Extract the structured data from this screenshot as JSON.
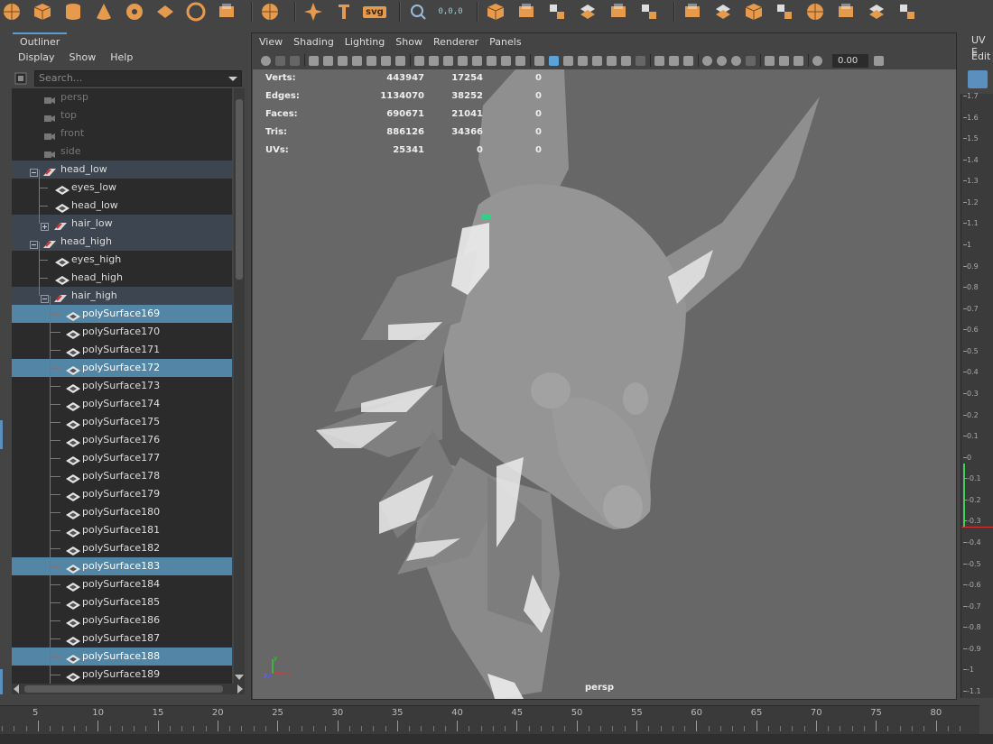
{
  "shelf": {
    "icons": [
      "sphere-icon",
      "cube-icon",
      "cylinder-icon",
      "cone-icon",
      "torus-icon",
      "plane-icon",
      "disc-icon",
      "soccerball-icon",
      "star-icon",
      "text-icon",
      "svg-icon",
      "sculpt-icon",
      "snap-icon",
      "polygon-tools-icon",
      "combine-icon",
      "separate-icon",
      "extract-icon",
      "bridge-icon",
      "extrude-icon",
      "bevel-icon",
      "append-icon",
      "insert-loop-icon",
      "multi-cut-icon",
      "target-weld-icon",
      "connect-icon",
      "collapse-icon",
      "smooth-icon",
      "mirror-icon",
      "reduce-icon"
    ],
    "svg_label": "svg",
    "coord_label": "0,0,0"
  },
  "outliner": {
    "tab": "Outliner",
    "menu": [
      "Display",
      "Show",
      "Help"
    ],
    "search_placeholder": "Search...",
    "cameras": [
      "persp",
      "top",
      "front",
      "side"
    ],
    "groups": {
      "head_low": "head_low",
      "eyes_low": "eyes_low",
      "head_low_mesh": "head_low",
      "hair_low": "hair_low",
      "head_high": "head_high",
      "eyes_high": "eyes_high",
      "head_high_mesh": "head_high",
      "hair_high": "hair_high"
    },
    "surfaces": [
      {
        "name": "polySurface169",
        "selected": true
      },
      {
        "name": "polySurface170",
        "selected": false
      },
      {
        "name": "polySurface171",
        "selected": false
      },
      {
        "name": "polySurface172",
        "selected": true
      },
      {
        "name": "polySurface173",
        "selected": false
      },
      {
        "name": "polySurface174",
        "selected": false
      },
      {
        "name": "polySurface175",
        "selected": false
      },
      {
        "name": "polySurface176",
        "selected": false
      },
      {
        "name": "polySurface177",
        "selected": false
      },
      {
        "name": "polySurface178",
        "selected": false
      },
      {
        "name": "polySurface179",
        "selected": false
      },
      {
        "name": "polySurface180",
        "selected": false
      },
      {
        "name": "polySurface181",
        "selected": false
      },
      {
        "name": "polySurface182",
        "selected": false
      },
      {
        "name": "polySurface183",
        "selected": true
      },
      {
        "name": "polySurface184",
        "selected": false
      },
      {
        "name": "polySurface185",
        "selected": false
      },
      {
        "name": "polySurface186",
        "selected": false
      },
      {
        "name": "polySurface187",
        "selected": false
      },
      {
        "name": "polySurface188",
        "selected": true
      },
      {
        "name": "polySurface189",
        "selected": false
      }
    ]
  },
  "viewport": {
    "menu": [
      "View",
      "Shading",
      "Lighting",
      "Show",
      "Renderer",
      "Panels"
    ],
    "zoom_value": "0.00",
    "camera": "persp",
    "hud": [
      {
        "label": "Verts:",
        "v1": "443947",
        "v2": "17254",
        "v3": "0"
      },
      {
        "label": "Edges:",
        "v1": "1134070",
        "v2": "38252",
        "v3": "0"
      },
      {
        "label": "Faces:",
        "v1": "690671",
        "v2": "21041",
        "v3": "0"
      },
      {
        "label": "Tris:",
        "v1": "886126",
        "v2": "34366",
        "v3": "0"
      },
      {
        "label": "UVs:",
        "v1": "25341",
        "v2": "0",
        "v3": "0"
      }
    ],
    "axis": {
      "x": "x",
      "y": "y",
      "z": "z"
    }
  },
  "uv_panel": {
    "title": "UV E",
    "menu": "Edit",
    "ticks": [
      "1.7",
      "1.6",
      "1.5",
      "1.4",
      "1.3",
      "1.2",
      "1.1",
      "1",
      "0.9",
      "0.8",
      "0.7",
      "0.6",
      "0.5",
      "0.4",
      "0.3",
      "0.2",
      "0.1",
      "0",
      "-0.1",
      "-0.2",
      "-0.3",
      "-0.4",
      "-0.5",
      "-0.6",
      "-0.7",
      "-0.8",
      "-0.9",
      "-1",
      "-1.1"
    ]
  },
  "timeline": {
    "labels": [
      "5",
      "10",
      "15",
      "20",
      "25",
      "30",
      "35",
      "40",
      "45",
      "50",
      "55",
      "60",
      "65",
      "70",
      "75",
      "80"
    ]
  },
  "colors": {
    "shelf_orange": "#e59a4e",
    "selection": "#5285a6",
    "group_row": "#3d4650",
    "viewport_bg": "#676767",
    "highlight_blue": "#5aa2d8"
  }
}
